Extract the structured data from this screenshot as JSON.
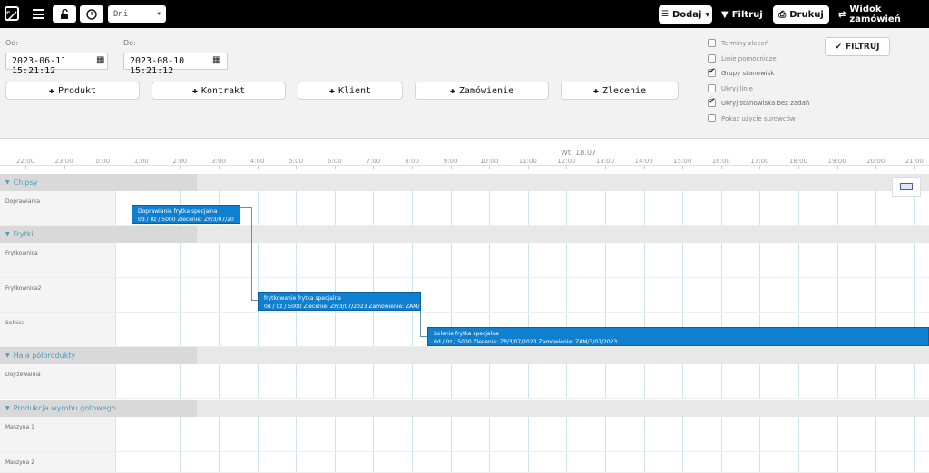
{
  "topbar": {
    "view_select": "Dni",
    "add_label": "Dodaj",
    "filter_label": "Filtruj",
    "print_label": "Drukuj",
    "orders_view_label": "Widok zamówień"
  },
  "filters": {
    "from_label": "Od:",
    "from_value": "2023-06-11 15:21:12",
    "to_label": "Do:",
    "to_value": "2023-08-10 15:21:12",
    "add_buttons": [
      "Produkt",
      "Kontrakt",
      "Klient",
      "Zamówienie",
      "Zlecenie"
    ],
    "checkboxes": [
      {
        "label": "Terminy zleceń",
        "checked": false
      },
      {
        "label": "Linie pomocnicze",
        "checked": false
      },
      {
        "label": "Grupy stanowisk",
        "checked": true
      },
      {
        "label": "Ukryj linie",
        "checked": false
      },
      {
        "label": "Ukryj stanowiska bez zadań",
        "checked": true
      },
      {
        "label": "Pokaż użycie surowców",
        "checked": false
      }
    ],
    "apply_label": "FILTRUJ"
  },
  "timeline": {
    "day_label": "Wt. 18.07",
    "hours": [
      "22:00",
      "23:00",
      "0:00",
      "1:00",
      "2:00",
      "3:00",
      "4:00",
      "5:00",
      "6:00",
      "7:00",
      "8:00",
      "9:00",
      "10:00",
      "11:00",
      "12:00",
      "13:00",
      "14:00",
      "15:00",
      "16:00",
      "17:00",
      "18:00",
      "19:00",
      "20:00",
      "21:00"
    ]
  },
  "groups": {
    "chipsy": "Chipsy",
    "frytki": "Frytki",
    "hala": "Hala półprodukty",
    "produkcja": "Produkcja wyrobu gotowego"
  },
  "rows": {
    "doprawiarka": "Doprawiarka",
    "frytkownica": "Frytkownica",
    "frytkownica2": "Frytkownica2",
    "solnica": "Solnica",
    "dojrzewalnia": "Dojrzewalnia",
    "maszyna1": "Maszyna 1",
    "maszyna2": "Maszyna 2"
  },
  "tasks": {
    "t1": {
      "title": "Doprawianie frytka specjalna",
      "detail": "0d / 0z / 5000 Zlecenie: ZP/3/07/20"
    },
    "t2": {
      "title": "frytkowanie frytka specjalna",
      "detail": "0d / 0z / 5000 Zlecenie: ZP/3/07/2023 Zamówienie: ZAM/"
    },
    "t3": {
      "title": "Solenie frytka specjalna",
      "detail": "0d / 0z / 5000 Zlecenie: ZP/3/07/2023 Zamówienie: ZAM/3/07/2023"
    }
  },
  "colors": {
    "task_bar": "#0f7fd0",
    "group_text": "#4a9dbf",
    "topbar": "#000000"
  }
}
